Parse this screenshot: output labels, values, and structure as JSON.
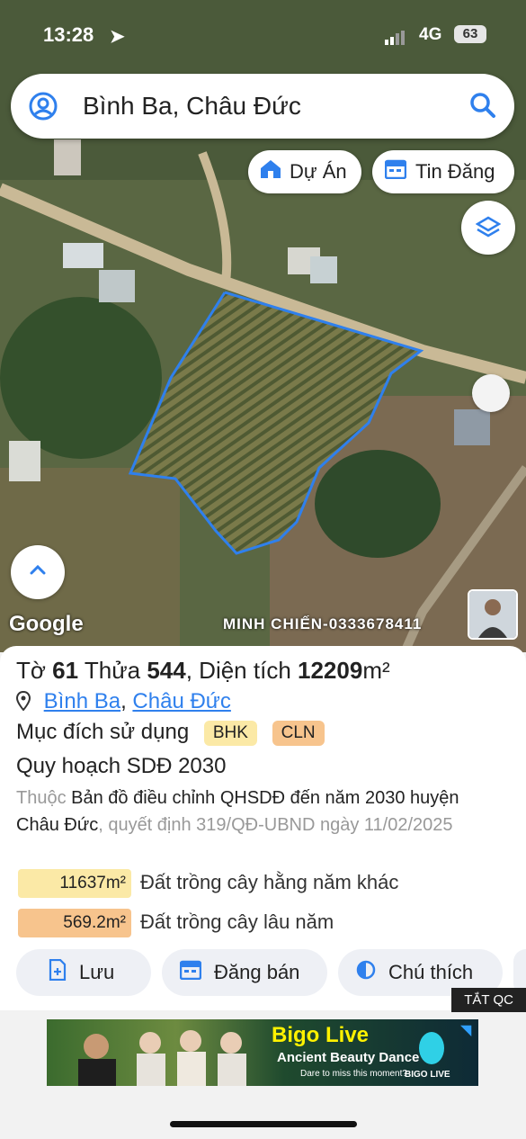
{
  "status": {
    "time": "13:28",
    "network": "4G",
    "battery": "63"
  },
  "search": {
    "value": "Bình Ba, Châu Đức"
  },
  "map_pills": {
    "du_an": "Dự Án",
    "tin_dang": "Tin Đăng"
  },
  "map": {
    "google": "Google",
    "watermark": "MINH CHIẾN-0333678411",
    "boundary_color": "#2f80ed"
  },
  "parcel": {
    "to_label": "Tờ",
    "to": "61",
    "thua_label": "Thửa",
    "thua": "544",
    "area_label": "Diện tích",
    "area": "12209",
    "area_unit": "m²",
    "location_1": "Bình Ba",
    "location_sep": ",",
    "location_2": "Châu Đức",
    "purpose_label": "Mục đích sử dụng",
    "tag_1": "BHK",
    "tag_2": "CLN",
    "plan_title": "Quy hoạch SDĐ 2030",
    "plan_prefix": "Thuộc",
    "plan_name": "Bản đồ điều chỉnh QHSDĐ đến năm 2030 huyện Châu Đức",
    "plan_decision": ", quyết định 319/QĐ-UBND ngày 11/02/2025",
    "legend": [
      {
        "area": "11637m²",
        "label": "Đất trồng cây hằng năm khác",
        "color": "#fbe9a6"
      },
      {
        "area": "569.2m²",
        "label": "Đất trồng cây lâu năm",
        "color": "#f7c48d"
      }
    ]
  },
  "actions": {
    "luu": "Lưu",
    "dang_ban": "Đăng bán",
    "chu_thich": "Chú thích"
  },
  "ad": {
    "close": "TẮT QC",
    "brand": "Bigo Live",
    "tagline": "Ancient Beauty Dance",
    "cta": "Dare to miss this moment?",
    "logo_text": "BIGO LIVE"
  }
}
